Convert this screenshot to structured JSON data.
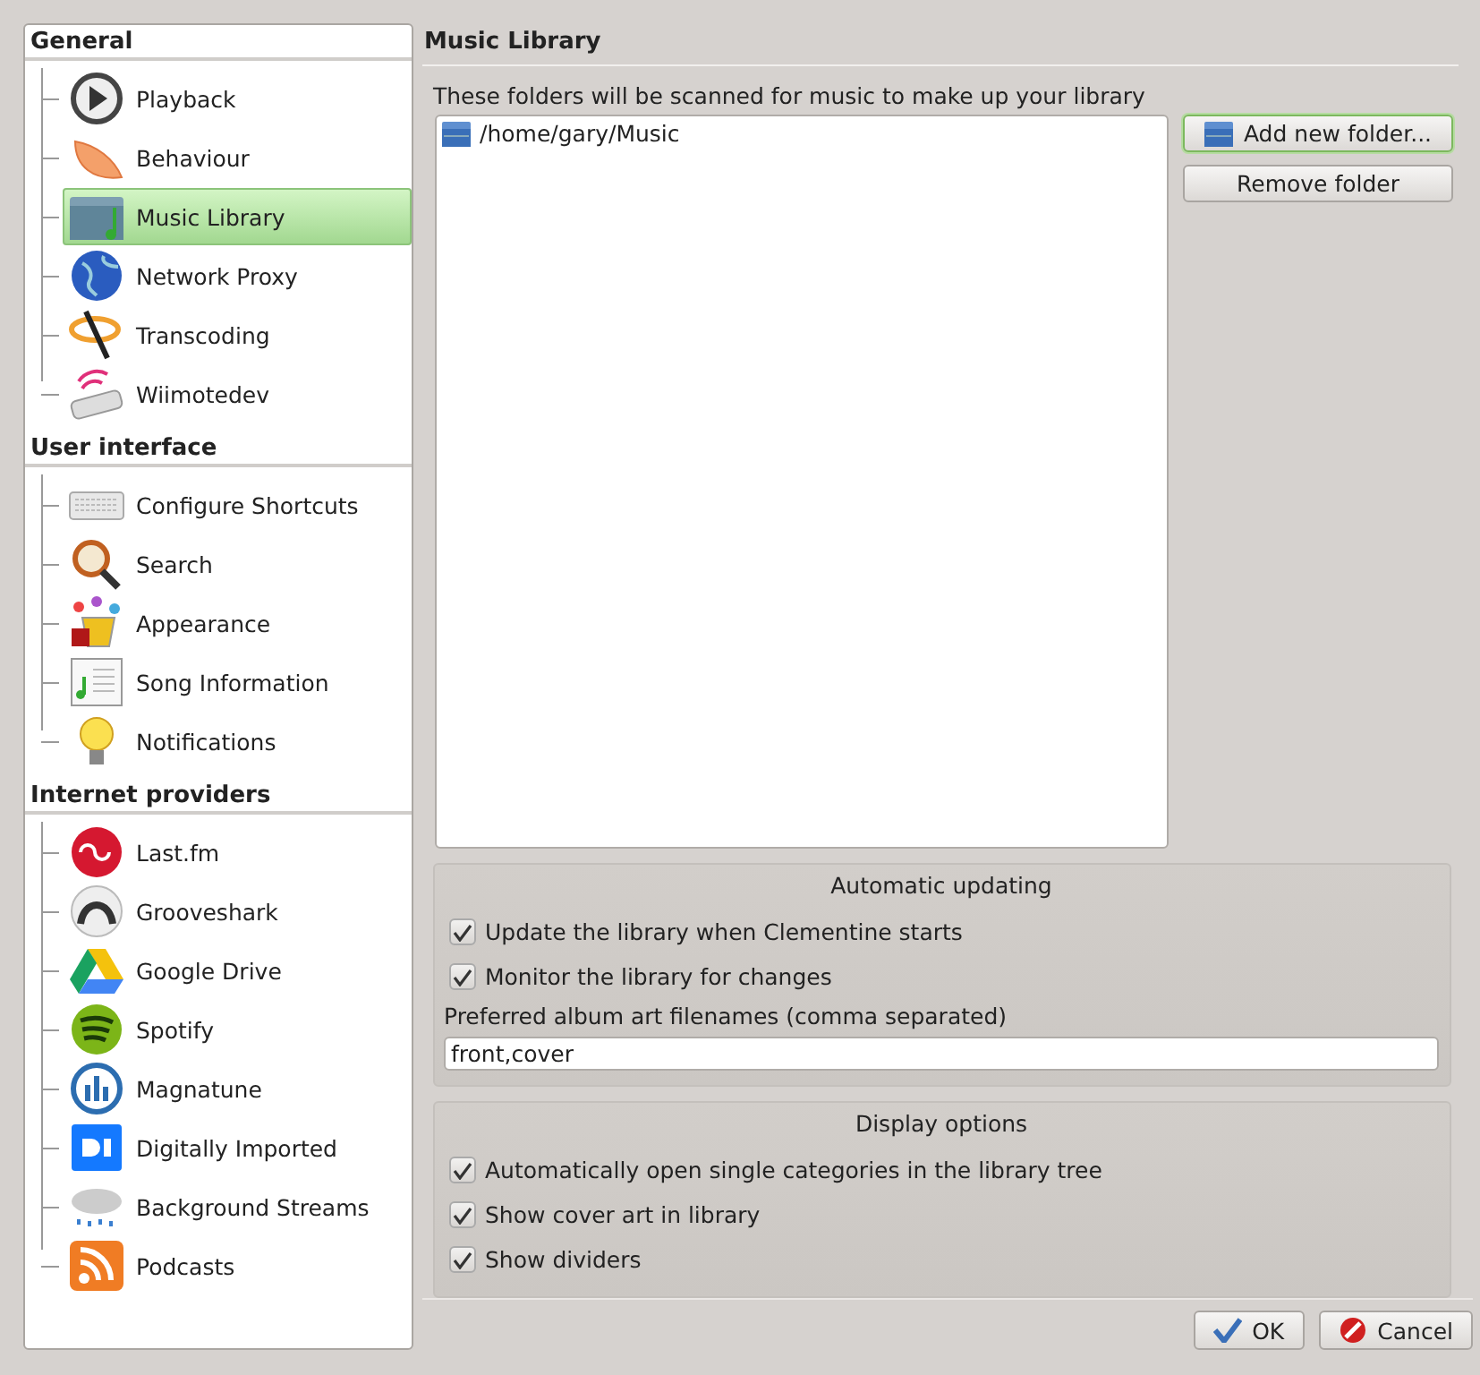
{
  "sidebar": {
    "sections": [
      {
        "title": "General",
        "items": [
          {
            "label": "Playback",
            "selected": false
          },
          {
            "label": "Behaviour",
            "selected": false
          },
          {
            "label": "Music Library",
            "selected": true
          },
          {
            "label": "Network Proxy",
            "selected": false
          },
          {
            "label": "Transcoding",
            "selected": false
          },
          {
            "label": "Wiimotedev",
            "selected": false
          }
        ]
      },
      {
        "title": "User interface",
        "items": [
          {
            "label": "Configure Shortcuts",
            "selected": false
          },
          {
            "label": "Search",
            "selected": false
          },
          {
            "label": "Appearance",
            "selected": false
          },
          {
            "label": "Song Information",
            "selected": false
          },
          {
            "label": "Notifications",
            "selected": false
          }
        ]
      },
      {
        "title": "Internet providers",
        "items": [
          {
            "label": "Last.fm",
            "selected": false
          },
          {
            "label": "Grooveshark",
            "selected": false
          },
          {
            "label": "Google Drive",
            "selected": false
          },
          {
            "label": "Spotify",
            "selected": false
          },
          {
            "label": "Magnatune",
            "selected": false
          },
          {
            "label": "Digitally Imported",
            "selected": false
          },
          {
            "label": "Background Streams",
            "selected": false
          },
          {
            "label": "Podcasts",
            "selected": false
          }
        ]
      }
    ]
  },
  "page": {
    "title": "Music Library",
    "description": "These folders will be scanned for music to make up your library",
    "folders": [
      {
        "path": "/home/gary/Music"
      }
    ],
    "folder_buttons": [
      "Add new folder...",
      "Remove folder"
    ],
    "groups": [
      {
        "title": "Automatic updating",
        "checkboxes": [
          {
            "label": "Update the library when Clementine starts",
            "checked": true
          },
          {
            "label": "Monitor the library for changes",
            "checked": true
          }
        ],
        "field": {
          "label": "Preferred album art filenames (comma separated)",
          "value": "front,cover"
        }
      },
      {
        "title": "Display options",
        "checkboxes": [
          {
            "label": "Automatically open single categories in the library tree",
            "checked": true
          },
          {
            "label": "Show cover art in library",
            "checked": true
          },
          {
            "label": "Show dividers",
            "checked": true
          }
        ]
      }
    ]
  },
  "buttons": [
    {
      "label": "OK",
      "kind": "ok"
    },
    {
      "label": "Cancel",
      "kind": "cancel"
    }
  ]
}
